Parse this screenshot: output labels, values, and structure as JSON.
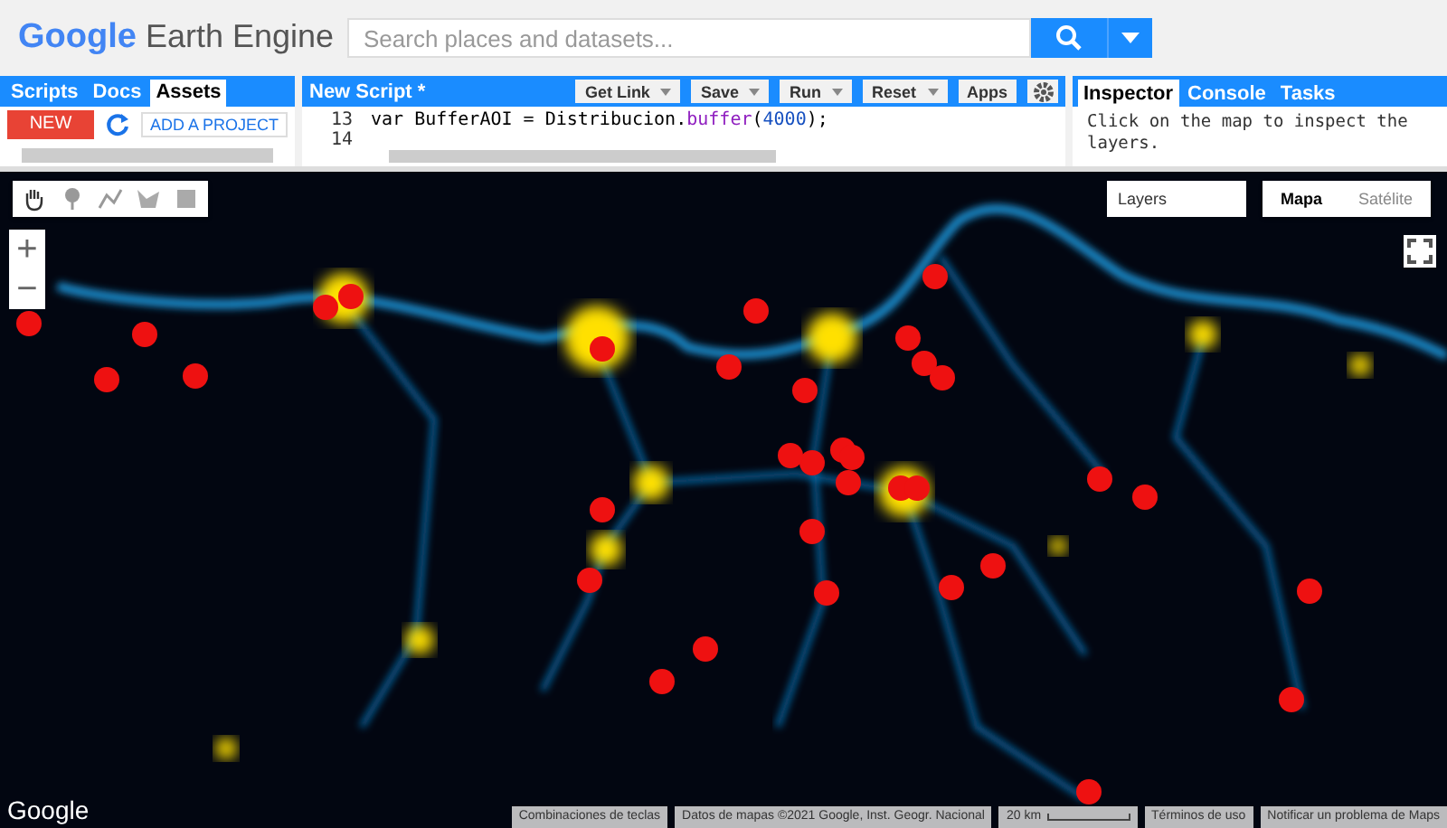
{
  "header": {
    "logo_google": "Google",
    "logo_product": "Earth Engine",
    "search": {
      "placeholder": "Search places and datasets..."
    }
  },
  "left_panel": {
    "tabs": [
      {
        "label": "Scripts",
        "selected": false
      },
      {
        "label": "Docs",
        "selected": false
      },
      {
        "label": "Assets",
        "selected": true
      }
    ],
    "new_button": "NEW",
    "add_project": "ADD A PROJECT"
  },
  "editor": {
    "title": "New Script *",
    "buttons": [
      "Get Link",
      "Save",
      "Run",
      "Reset"
    ],
    "apps_button": "Apps",
    "lines": [
      {
        "number": "13",
        "tokens": [
          {
            "text": "var BufferAOI = Distribucion.",
            "kind": "plain"
          },
          {
            "text": "buffer",
            "kind": "method"
          },
          {
            "text": "(",
            "kind": "plain"
          },
          {
            "text": "4000",
            "kind": "number"
          },
          {
            "text": ");",
            "kind": "plain"
          }
        ]
      },
      {
        "number": "14"
      }
    ]
  },
  "right_panel": {
    "tabs": [
      {
        "label": "Inspector",
        "selected": true
      },
      {
        "label": "Console",
        "selected": false
      },
      {
        "label": "Tasks",
        "selected": false
      }
    ],
    "message": "Click on the map to inspect the layers."
  },
  "map": {
    "layers_button": "Layers",
    "map_types": [
      {
        "label": "Mapa",
        "selected": true
      },
      {
        "label": "Satélite",
        "selected": false
      }
    ],
    "zoom_in": "+",
    "zoom_out": "−",
    "logo": "Google",
    "footer": {
      "shortcuts": "Combinaciones de teclas",
      "attribution": "Datos de mapas ©2021 Google, Inst. Geogr. Nacional",
      "scale": "20 km",
      "terms": "Términos de uso",
      "report": "Notificar un problema de Maps"
    }
  }
}
